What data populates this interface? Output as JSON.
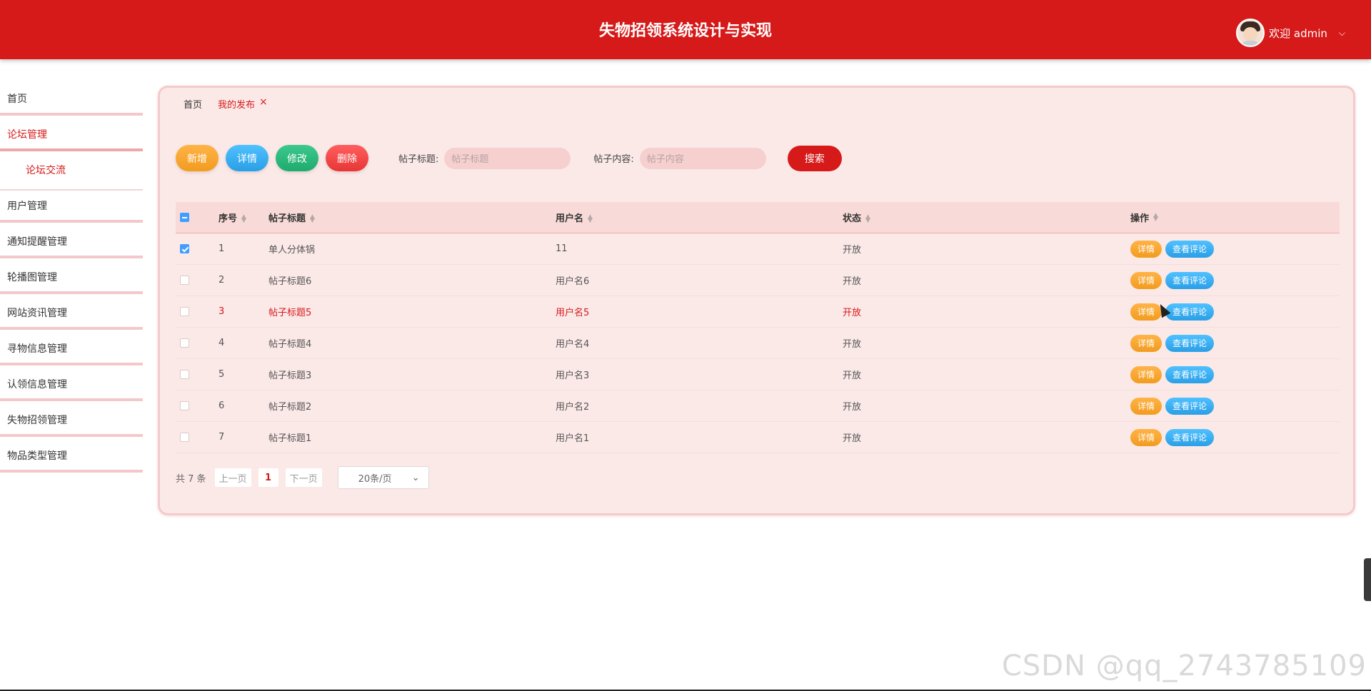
{
  "header": {
    "title": "失物招领系统设计与实现",
    "welcome": "欢迎 admin",
    "caret": "⌵"
  },
  "sidebar": {
    "items": [
      {
        "label": "首页"
      },
      {
        "label": "论坛管理"
      },
      {
        "label": "论坛交流"
      },
      {
        "label": "用户管理"
      },
      {
        "label": "通知提醒管理"
      },
      {
        "label": "轮播图管理"
      },
      {
        "label": "网站资讯管理"
      },
      {
        "label": "寻物信息管理"
      },
      {
        "label": "认领信息管理"
      },
      {
        "label": "失物招领管理"
      },
      {
        "label": "物品类型管理"
      }
    ]
  },
  "tabs": {
    "home": "首页",
    "current": "我的发布",
    "close": "×"
  },
  "toolbar": {
    "add": "新增",
    "detail": "详情",
    "edit": "修改",
    "delete": "删除",
    "title_label": "帖子标题:",
    "title_placeholder": "帖子标题",
    "content_label": "帖子内容:",
    "content_placeholder": "帖子内容",
    "search": "搜索"
  },
  "table": {
    "headers": {
      "index": "序号",
      "title": "帖子标题",
      "username": "用户名",
      "status": "状态",
      "actions": "操作"
    },
    "rows": [
      {
        "index": "1",
        "title": "单人分体锅",
        "username": "11",
        "status": "开放"
      },
      {
        "index": "2",
        "title": "帖子标题6",
        "username": "用户名6",
        "status": "开放"
      },
      {
        "index": "3",
        "title": "帖子标题5",
        "username": "用户名5",
        "status": "开放"
      },
      {
        "index": "4",
        "title": "帖子标题4",
        "username": "用户名4",
        "status": "开放"
      },
      {
        "index": "5",
        "title": "帖子标题3",
        "username": "用户名3",
        "status": "开放"
      },
      {
        "index": "6",
        "title": "帖子标题2",
        "username": "用户名2",
        "status": "开放"
      },
      {
        "index": "7",
        "title": "帖子标题1",
        "username": "用户名1",
        "status": "开放"
      }
    ],
    "row_actions": {
      "detail": "详情",
      "comments": "查看评论"
    }
  },
  "pager": {
    "total": "共 7 条",
    "prev": "上一页",
    "page": "1",
    "next": "下一页",
    "size": "20条/页"
  },
  "watermark": "CSDN @qq_2743785109",
  "colors": {
    "brand": "#d61a19",
    "panel_bg": "#fbe9e8"
  }
}
